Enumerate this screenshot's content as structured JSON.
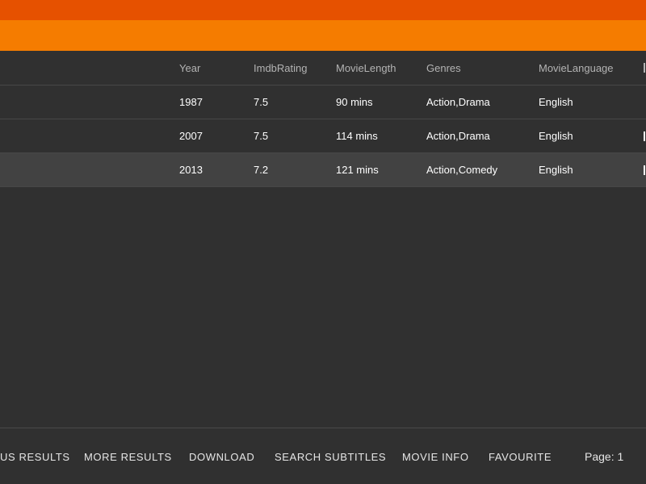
{
  "table": {
    "columns": {
      "year": "Year",
      "rating": "ImdbRating",
      "length": "MovieLength",
      "genres": "Genres",
      "language": "MovieLanguage"
    },
    "rows": [
      {
        "year": "1987",
        "rating": "7.5",
        "length": "90 mins",
        "genres": "Action,Drama",
        "language": "English"
      },
      {
        "year": "2007",
        "rating": "7.5",
        "length": "114 mins",
        "genres": "Action,Drama",
        "language": "English"
      },
      {
        "year": "2013",
        "rating": "7.2",
        "length": "121 mins",
        "genres": "Action,Comedy",
        "language": "English"
      }
    ]
  },
  "footer": {
    "previous_label": "US RESULTS",
    "more_label": "MORE RESULTS",
    "download_label": "DOWNLOAD",
    "subtitles_label": "SEARCH SUBTITLES",
    "info_label": "MOVIE INFO",
    "favourite_label": "FAVOURITE",
    "page_label": "Page: 1"
  },
  "colors": {
    "status_bar": "#e65100",
    "app_bar": "#f57c00",
    "background": "#303030",
    "selected_row": "#424242"
  }
}
